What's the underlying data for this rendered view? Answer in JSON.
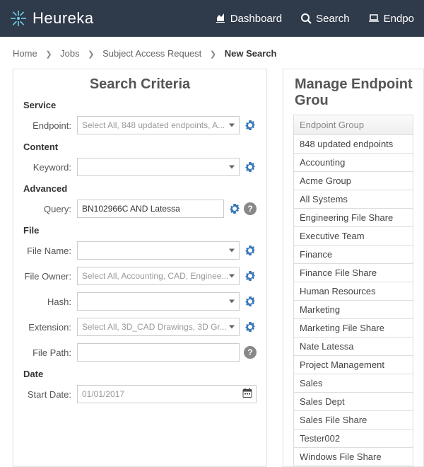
{
  "header": {
    "brand": "Heureka",
    "nav": [
      {
        "id": "dashboard",
        "label": "Dashboard"
      },
      {
        "id": "search",
        "label": "Search"
      },
      {
        "id": "endpoints",
        "label": "Endpo"
      }
    ]
  },
  "breadcrumbs": [
    {
      "label": "Home"
    },
    {
      "label": "Jobs"
    },
    {
      "label": "Subject Access Request"
    },
    {
      "label": "New Search",
      "current": true
    }
  ],
  "criteria": {
    "title": "Search Criteria",
    "sections": {
      "service": {
        "heading": "Service"
      },
      "content": {
        "heading": "Content"
      },
      "advanced": {
        "heading": "Advanced"
      },
      "file": {
        "heading": "File"
      },
      "date": {
        "heading": "Date"
      }
    },
    "fields": {
      "endpoint": {
        "label": "Endpoint:",
        "placeholder": "Select All, 848 updated endpoints, A..."
      },
      "keyword": {
        "label": "Keyword:",
        "placeholder": ""
      },
      "query": {
        "label": "Query:",
        "value": "BN102966C AND Latessa"
      },
      "file_name": {
        "label": "File Name:",
        "placeholder": ""
      },
      "file_owner": {
        "label": "File Owner:",
        "placeholder": "Select All, Accounting, CAD, Enginee..."
      },
      "hash": {
        "label": "Hash:",
        "placeholder": ""
      },
      "extension": {
        "label": "Extension:",
        "placeholder": "Select All, 3D_CAD Drawings, 3D Gr..."
      },
      "file_path": {
        "label": "File Path:",
        "placeholder": ""
      },
      "start_date": {
        "label": "Start Date:",
        "placeholder": "01/01/2017"
      }
    }
  },
  "groups": {
    "title": "Manage Endpoint Grou",
    "column_header": "Endpoint Group",
    "rows": [
      "848 updated endpoints",
      "Accounting",
      "Acme Group",
      "All Systems",
      "Engineering File Share",
      "Executive Team",
      "Finance",
      "Finance File Share",
      "Human Resources",
      "Marketing",
      "Marketing File Share",
      "Nate Latessa",
      "Project Management",
      "Sales",
      "Sales Dept",
      "Sales File Share",
      "Tester002",
      "Windows File Share"
    ]
  }
}
